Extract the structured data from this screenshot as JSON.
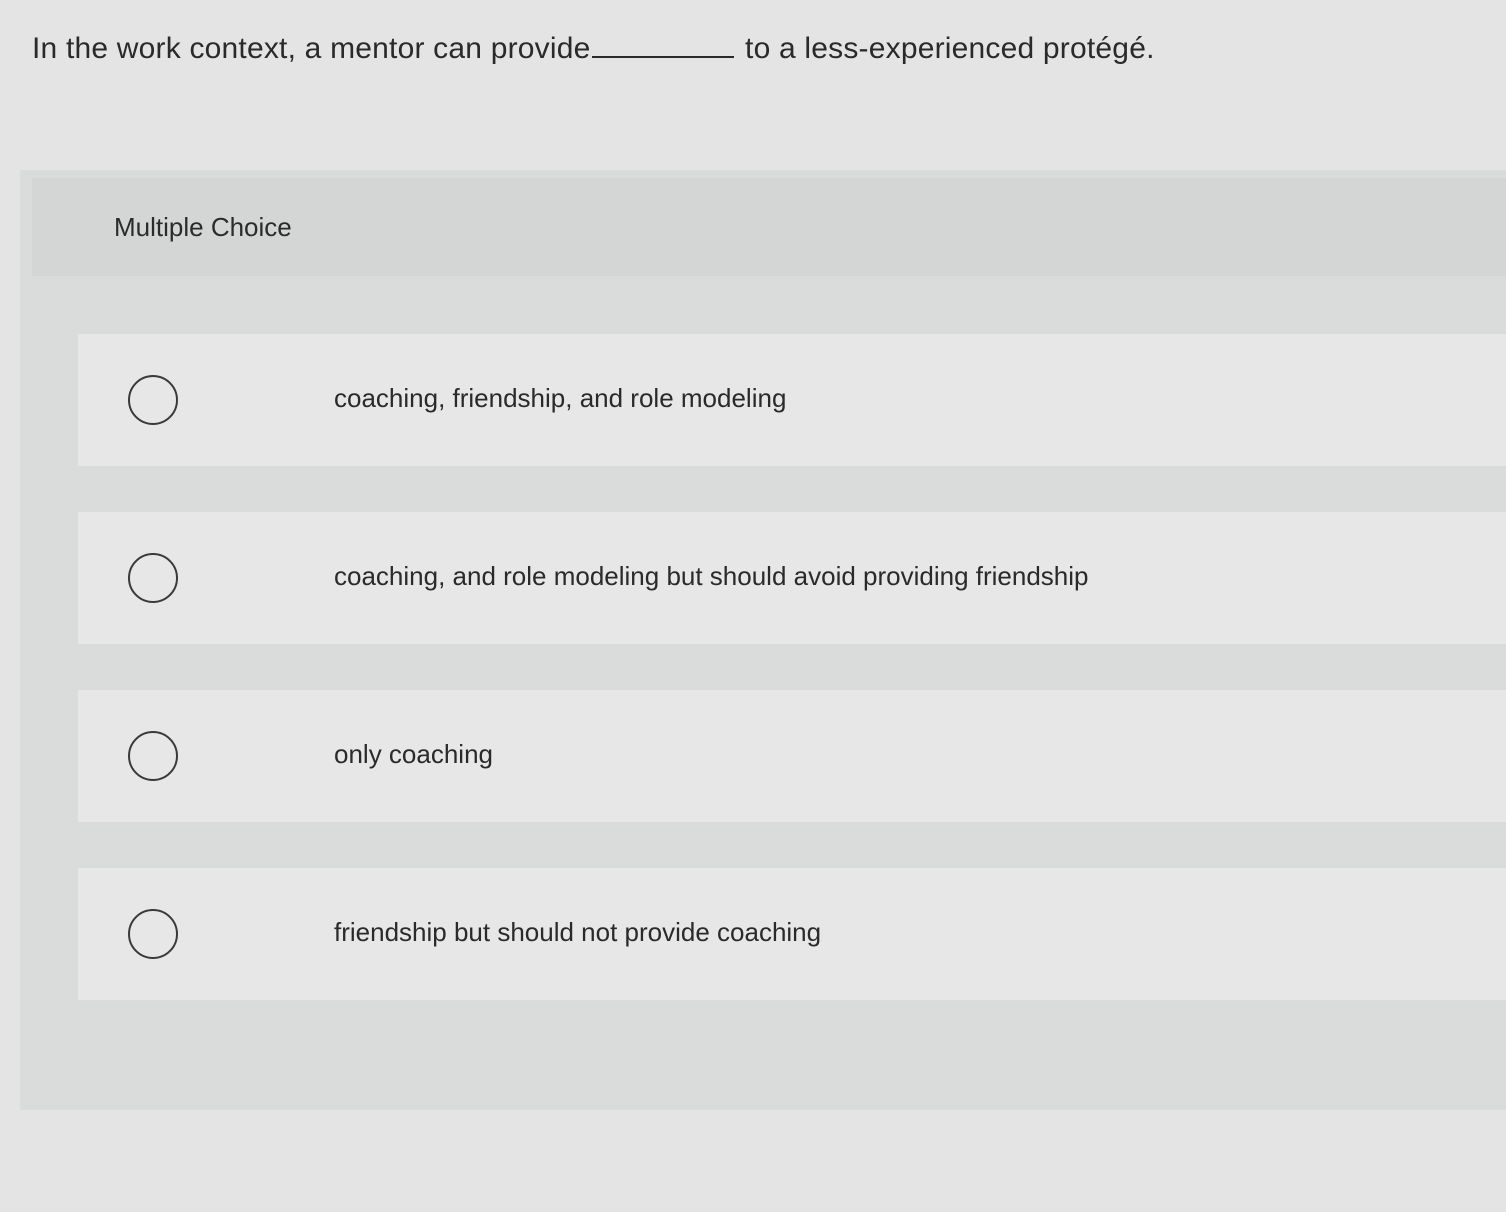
{
  "question": {
    "before_blank": "In the work context, a mentor can provide",
    "after_blank": "to a less-experienced protégé."
  },
  "panel": {
    "label": "Multiple Choice"
  },
  "options": [
    {
      "text": "coaching, friendship, and role modeling",
      "selected": false
    },
    {
      "text": "coaching, and role modeling but should avoid providing friendship",
      "selected": false
    },
    {
      "text": "only coaching",
      "selected": false
    },
    {
      "text": "friendship but should not provide coaching",
      "selected": false
    }
  ]
}
